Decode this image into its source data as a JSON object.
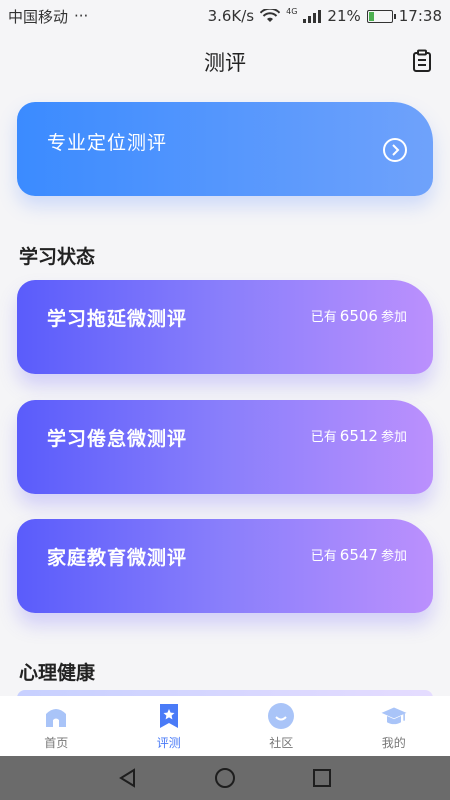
{
  "statusbar": {
    "carrier": "中国移动",
    "more": "···",
    "speed": "3.6K/s",
    "network": "4G",
    "battery_pct": "21%",
    "battery_level": 0.21,
    "time": "17:38"
  },
  "header": {
    "title": "测评"
  },
  "hero": {
    "title": "专业定位测评"
  },
  "sections": [
    {
      "title": "学习状态"
    },
    {
      "title": "心理健康"
    }
  ],
  "evaluations": [
    {
      "title": "学习拖延微测评",
      "prefix": "已有",
      "count": "6506",
      "suffix": "参加"
    },
    {
      "title": "学习倦怠微测评",
      "prefix": "已有",
      "count": "6512",
      "suffix": "参加"
    },
    {
      "title": "家庭教育微测评",
      "prefix": "已有",
      "count": "6547",
      "suffix": "参加"
    }
  ],
  "tabs": [
    {
      "label": "首页",
      "icon": "home-icon"
    },
    {
      "label": "评测",
      "icon": "bookmark-star-icon"
    },
    {
      "label": "社区",
      "icon": "smile-icon"
    },
    {
      "label": "我的",
      "icon": "graduation-cap-icon"
    }
  ],
  "colors": {
    "accent": "#4a7bf7",
    "hero_gradient": [
      "#3b8bff",
      "#6fa2fb"
    ],
    "card_gradient": [
      "#5a5cfb",
      "#bb90fd"
    ]
  }
}
